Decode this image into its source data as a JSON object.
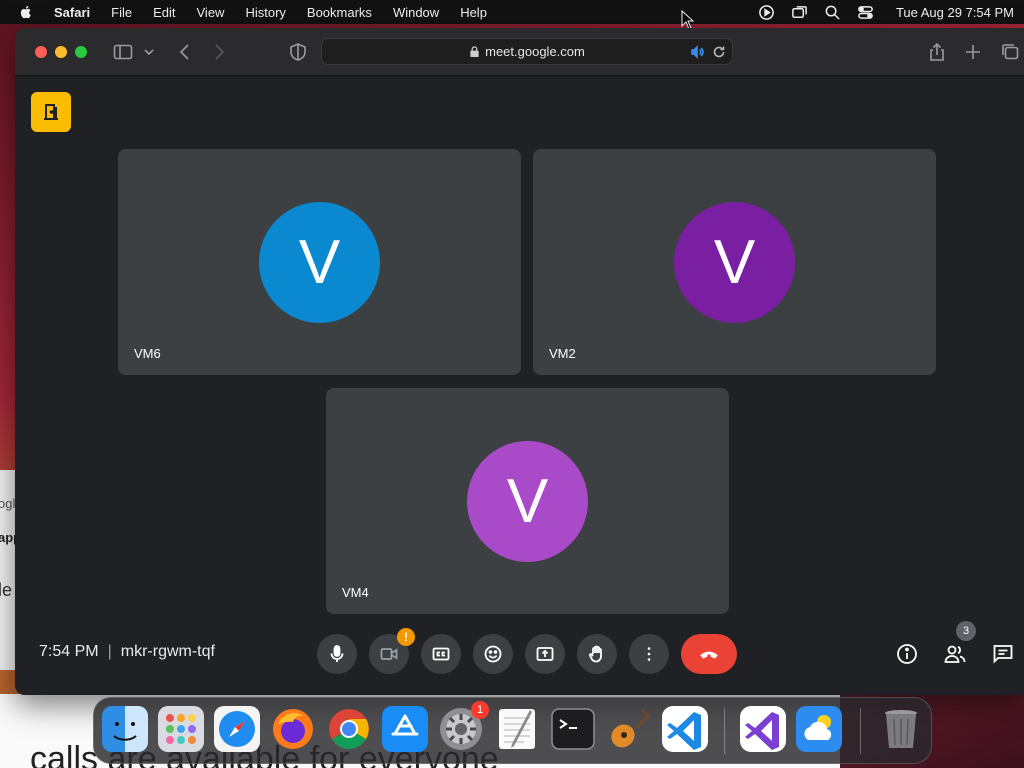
{
  "menubar": {
    "app": "Safari",
    "items": [
      "File",
      "Edit",
      "View",
      "History",
      "Bookmarks",
      "Window",
      "Help"
    ],
    "clock": "Tue Aug 29  7:54 PM"
  },
  "browser": {
    "url": "meet.google.com"
  },
  "meet": {
    "participants": [
      {
        "name": "VM6",
        "initial": "V",
        "color": "#0a88d0"
      },
      {
        "name": "VM2",
        "initial": "V",
        "color": "#7b1fa2"
      },
      {
        "name": "VM4",
        "initial": "V",
        "color": "#a94ac8"
      }
    ],
    "time": "7:54 PM",
    "separator": "|",
    "meeting_code": "mkr-rgwm-tqf",
    "camera_warning": "!",
    "people_count": "3"
  },
  "background": {
    "frag1": "ogl",
    "frag2": "app",
    "frag3": "le",
    "bottom_text": "calls are available for everyone"
  },
  "dock": {
    "settings_badge": "1",
    "apps": [
      "finder",
      "launchpad",
      "safari",
      "firefox",
      "chrome",
      "app-store",
      "system-settings",
      "textedit",
      "terminal",
      "garageband",
      "vscode",
      "visual-studio",
      "weather",
      "trash"
    ]
  }
}
